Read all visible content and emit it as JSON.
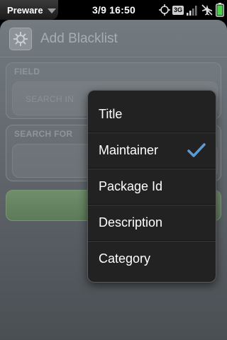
{
  "status_bar": {
    "app_menu_label": "Preware",
    "time": "3/9 16:50",
    "network_badge": "3G",
    "icons": [
      "gps-target-icon",
      "network-3g-icon",
      "signal-bars-icon",
      "airplane-mode-off-icon",
      "battery-icon"
    ]
  },
  "header": {
    "title": "Add Blacklist",
    "icon": "app-icon"
  },
  "form": {
    "field_group_label": "FIELD",
    "search_in_placeholder": "SEARCH IN",
    "search_for_group_label": "SEARCH FOR",
    "search_for_value": ""
  },
  "popup_menu": {
    "items": [
      {
        "label": "Title",
        "checked": false
      },
      {
        "label": "Maintainer",
        "checked": true
      },
      {
        "label": "Package Id",
        "checked": false
      },
      {
        "label": "Description",
        "checked": false
      },
      {
        "label": "Category",
        "checked": false
      }
    ],
    "check_color": "#5b9bd5"
  },
  "colors": {
    "background": "#000000",
    "app_surface": "#5e646a",
    "add_button": "#6a8a65",
    "popup_bg": "#222222"
  }
}
